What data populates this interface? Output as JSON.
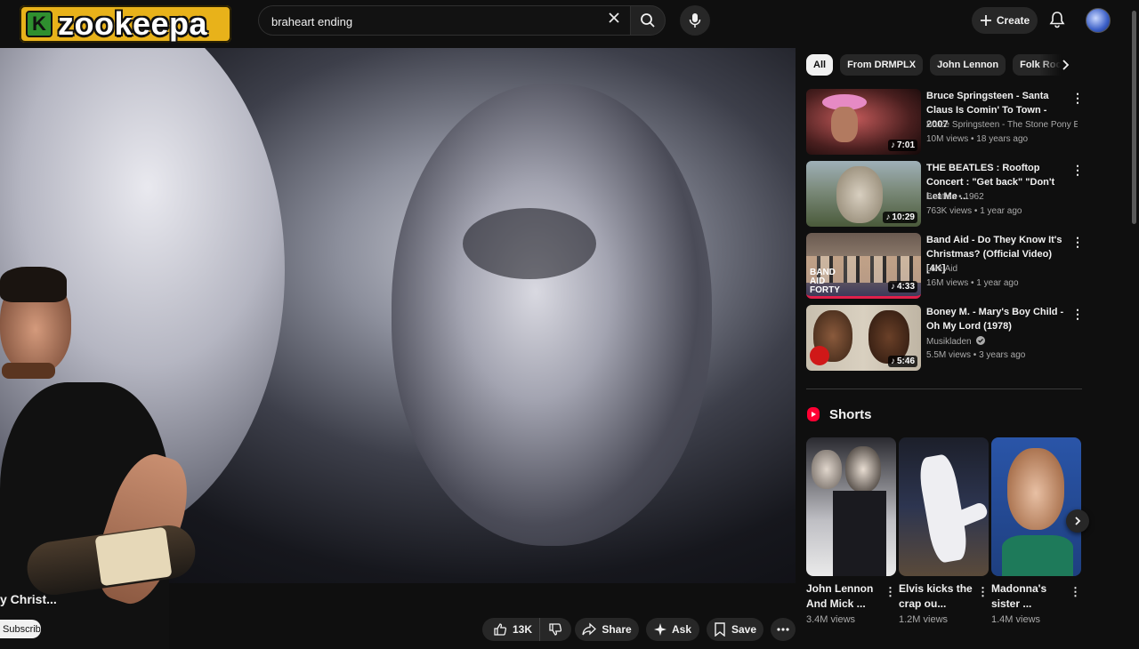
{
  "header": {
    "logo_letter": "K",
    "logo_text": "zookeepa",
    "search": {
      "value": "braheart ending",
      "placeholder": "Search"
    },
    "create_label": "Create"
  },
  "player": {
    "title_fragment": "y Christ...",
    "subscribe_label": "Subscrib"
  },
  "actions": {
    "likes": "13K",
    "share_label": "Share",
    "ask_label": "Ask",
    "save_label": "Save"
  },
  "chips": [
    "All",
    "From DRMPLX",
    "John Lennon",
    "Folk Rock"
  ],
  "recommendations": [
    {
      "title": "Bruce Springsteen - Santa Claus Is Comin' To Town - 2007",
      "channel": "Bruce Springsteen - The Stone Pony ES",
      "meta": "10M views • 18 years ago",
      "duration": "7:01"
    },
    {
      "title": "THE BEATLES : Rooftop Concert : \"Get back\"  \"Don't Let Me ...",
      "channel": "Beatles • 1962",
      "meta": "763K views • 1 year ago",
      "duration": "10:29"
    },
    {
      "title": "Band Aid - Do They Know It's Christmas? (Official Video) [4K]",
      "channel": "Live Aid",
      "meta": "16M views • 1 year ago",
      "duration": "4:33"
    },
    {
      "title": "Boney M. - Mary's Boy Child - Oh My Lord (1978)",
      "channel": "Musikladen",
      "meta": "5.5M views • 3 years ago",
      "duration": "5:46"
    }
  ],
  "shorts": {
    "heading": "Shorts",
    "items": [
      {
        "title": "John Lennon And Mick ...",
        "views": "3.4M views"
      },
      {
        "title": "Elvis kicks the crap ou...",
        "views": "1.2M views"
      },
      {
        "title": "Madonna's sister ...",
        "views": "1.4M views"
      }
    ]
  },
  "colors": {
    "background": "#0f0f0f",
    "chip_active": "#f1f1f1",
    "brand_red": "#ff0033",
    "logo_yellow": "#e8b21a"
  }
}
